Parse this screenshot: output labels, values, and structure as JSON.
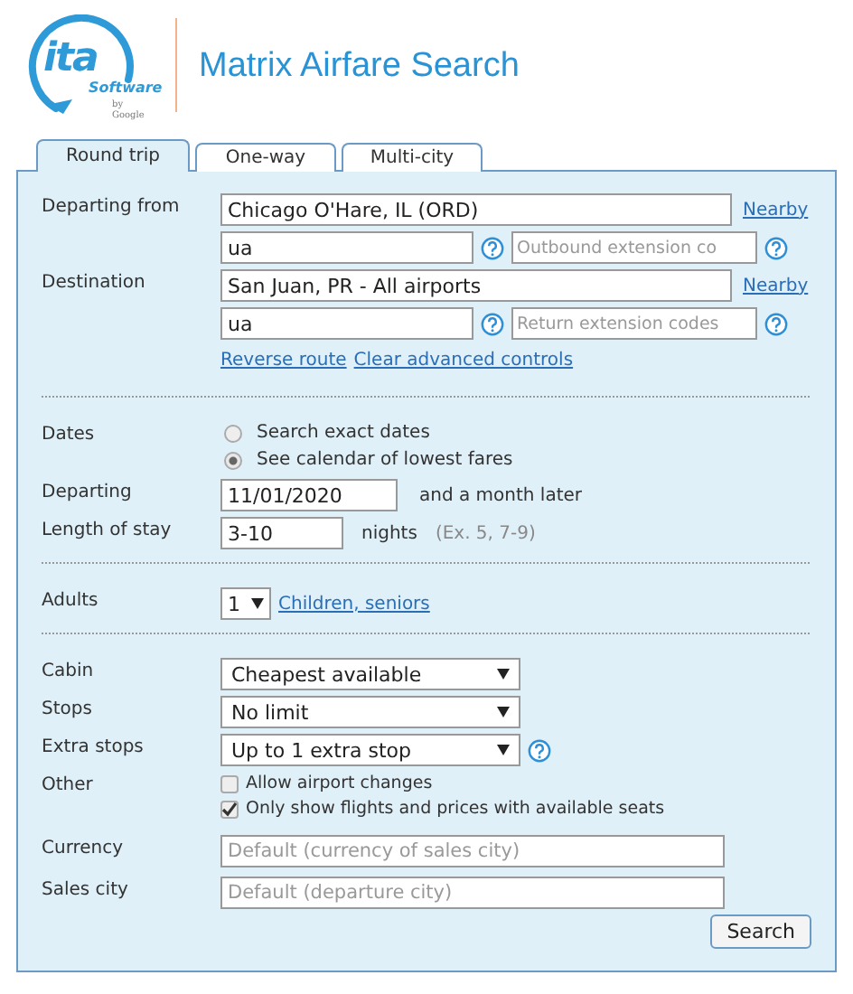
{
  "header": {
    "logo": {
      "mark": "ita",
      "word": "Software",
      "byline": "by Google"
    },
    "title": "Matrix Airfare Search"
  },
  "tabs": [
    {
      "label": "Round trip",
      "selected": true
    },
    {
      "label": "One-way",
      "selected": false
    },
    {
      "label": "Multi-city",
      "selected": false
    }
  ],
  "sections": [
    {
      "rows": [
        {
          "kind": "location",
          "label": "Departing from",
          "value": "Chicago O'Hare, IL (ORD)",
          "link": "Nearby"
        },
        {
          "kind": "codes",
          "value": "ua",
          "placeholder": "Outbound extension co"
        },
        {
          "kind": "location",
          "label": "Destination",
          "value": "San Juan, PR - All airports",
          "link": "Nearby"
        },
        {
          "kind": "codes",
          "value": "ua",
          "placeholder": "Return extension codes"
        },
        {
          "kind": "links",
          "links": [
            "Reverse route",
            "Clear advanced controls"
          ]
        }
      ]
    },
    {
      "rows": [
        {
          "kind": "radios",
          "label": "Dates",
          "options": [
            {
              "label": "Search exact dates",
              "selected": false
            },
            {
              "label": "See calendar of lowest fares",
              "selected": true
            }
          ]
        },
        {
          "kind": "date",
          "label": "Departing",
          "value": "11/01/2020",
          "note": "and a month later"
        },
        {
          "kind": "stay",
          "label": "Length of stay",
          "value": "3-10",
          "unit": "nights",
          "hint": "(Ex. 5, 7-9)"
        }
      ]
    },
    {
      "rows": [
        {
          "kind": "count",
          "label": "Adults",
          "value": "1",
          "link": "Children, seniors"
        }
      ]
    },
    {
      "rows": [
        {
          "kind": "select",
          "label": "Cabin",
          "value": "Cheapest available",
          "help": false
        },
        {
          "kind": "select",
          "label": "Stops",
          "value": "No limit",
          "help": false
        },
        {
          "kind": "select",
          "label": "Extra stops",
          "value": "Up to 1 extra stop",
          "help": true
        },
        {
          "kind": "checks",
          "label": "Other",
          "options": [
            {
              "label": "Allow airport changes",
              "checked": false
            },
            {
              "label": "Only show flights and prices with available seats",
              "checked": true
            }
          ]
        },
        {
          "kind": "text",
          "label": "Currency",
          "placeholder": "Default (currency of sales city)"
        },
        {
          "kind": "text",
          "label": "Sales city",
          "placeholder": "Default (departure city)"
        }
      ]
    }
  ],
  "search_button": "Search"
}
